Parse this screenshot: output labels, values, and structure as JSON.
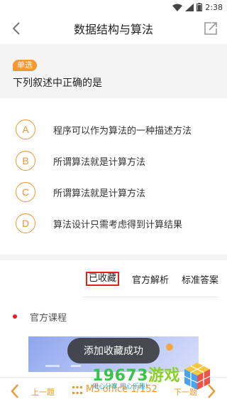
{
  "status_bar": {
    "time": "2:38"
  },
  "header": {
    "title": "数据结构与算法",
    "back_icon": "chevron-left-icon",
    "share_icon": "share-icon"
  },
  "question": {
    "type_badge": "单选",
    "text": "下列叙述中正确的是"
  },
  "options": [
    {
      "letter": "A",
      "text": "程序可以作为算法的一种描述方法"
    },
    {
      "letter": "B",
      "text": "所谓算法就是计算方法"
    },
    {
      "letter": "C",
      "text": "所谓算法就是计算方法"
    },
    {
      "letter": "D",
      "text": "算法设计只需考虑得到计算结果"
    }
  ],
  "tabs": {
    "collected": "已收藏",
    "official_analysis": "官方解析",
    "standard_answer": "标准答案"
  },
  "course": {
    "label": "官方课程"
  },
  "toast": {
    "text": "添加收藏成功"
  },
  "bottom_bar": {
    "prev": "上一题",
    "progress": "MS office 1/152",
    "next": "下一题"
  },
  "watermark": {
    "number": "19673",
    "name": "游戏",
    "sub": "用心分享  用心乐趣!"
  },
  "colors": {
    "accent": "#f0952e",
    "highlight_border": "#e0201a",
    "watermark_green": "#3cc24a"
  }
}
